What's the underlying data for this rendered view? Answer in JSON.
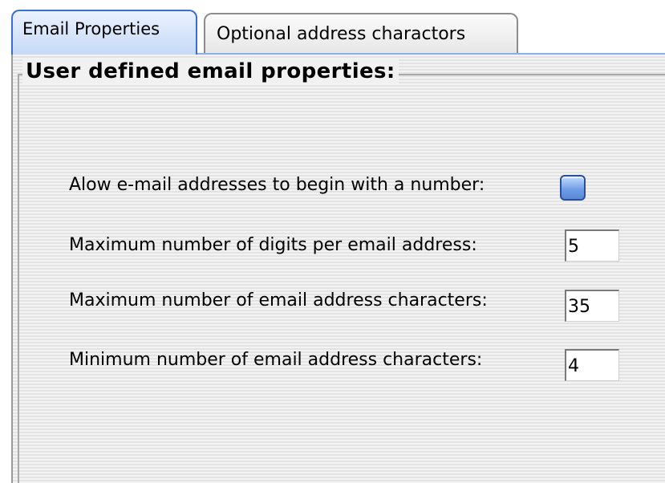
{
  "tabs": [
    {
      "label": "Email Properties",
      "active": true
    },
    {
      "label": "Optional address charactors",
      "active": false
    }
  ],
  "group": {
    "title": "User defined email properties:"
  },
  "settings": {
    "begin_with_number": {
      "label": "Alow e-mail addresses to begin with a number:",
      "checked": false
    },
    "max_digits": {
      "label": "Maximum number of digits per email address:",
      "value": "5"
    },
    "max_chars": {
      "label": "Maximum number of email address characters:",
      "value": "35"
    },
    "min_chars": {
      "label": "Minimum number of email address characters:",
      "value": "4"
    }
  },
  "colors": {
    "active_tab_border": "#3a6fd1",
    "checkbox_fill": "#6d9be6",
    "panel_bg": "#f1f1f1"
  }
}
